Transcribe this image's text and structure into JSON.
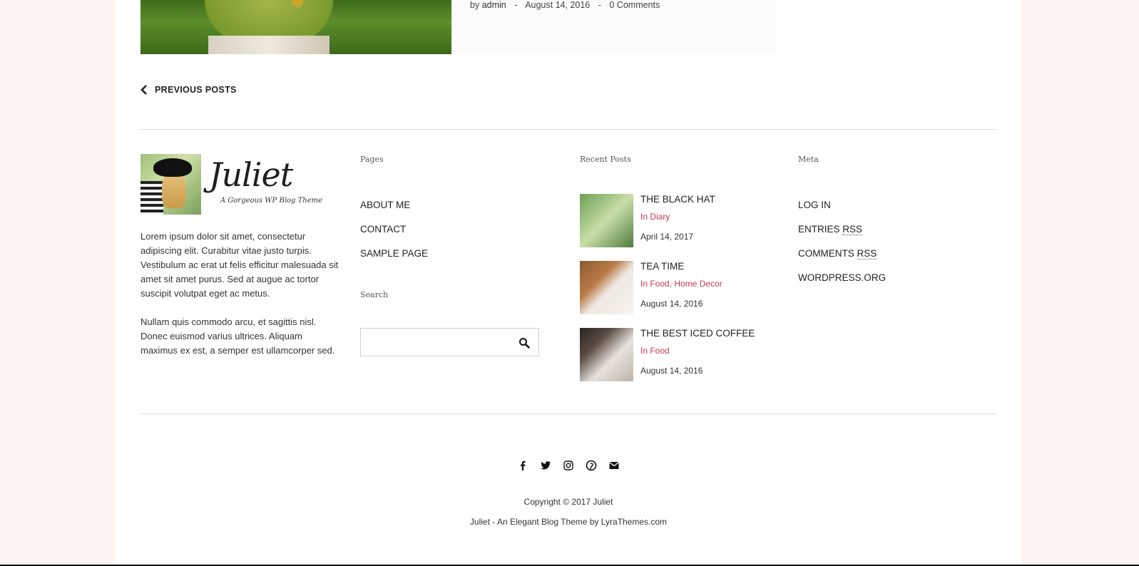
{
  "post": {
    "author_prefix": "by",
    "author": "admin",
    "separator": "-",
    "date": "August 14, 2016",
    "comments": "0 Comments"
  },
  "pagination": {
    "previous_label": "PREVIOUS POSTS"
  },
  "about": {
    "site_title": "Juliet",
    "tagline": "A Gorgeous WP Blog Theme",
    "paragraph_1": "Lorem ipsum dolor sit amet, consectetur adipiscing elit. Curabitur vitae justo turpis. Vestibulum ac erat ut felis efficitur malesuada sit amet sit amet purus. Sed at augue ac tortor suscipit volutpat eget ac metus.",
    "paragraph_2": "Nullam quis commodo arcu, et sagittis nisl. Donec euismod varius ultrices. Aliquam maximus ex est, a semper est ullamcorper sed."
  },
  "pages": {
    "title": "Pages",
    "items": [
      "ABOUT ME",
      "CONTACT",
      "SAMPLE PAGE"
    ]
  },
  "search": {
    "title": "Search",
    "placeholder": "",
    "icon": "search-icon"
  },
  "recent_posts": {
    "title": "Recent Posts",
    "items": [
      {
        "title": "THE BLACK HAT",
        "category": "In Diary",
        "date": "April 14, 2017"
      },
      {
        "title": "TEA TIME",
        "category": "In Food, Home Decor",
        "date": "August 14, 2016"
      },
      {
        "title": "THE BEST ICED COFFEE",
        "category": "In Food",
        "date": "August 14, 2016"
      }
    ]
  },
  "meta": {
    "title": "Meta",
    "login": "LOG IN",
    "entries_prefix": "ENTRIES",
    "comments_prefix": "COMMENTS",
    "rss": "RSS",
    "wordpress": "WORDPRESS.ORG"
  },
  "social": [
    "facebook-icon",
    "twitter-icon",
    "instagram-icon",
    "pinterest-icon",
    "envelope-icon"
  ],
  "footer": {
    "copyright": "Copyright © 2017 Juliet",
    "credit": "Juliet - An Elegant Blog Theme by LyraThemes.com"
  },
  "colors": {
    "accent": "#c8374a",
    "background": "#fdf3f1",
    "text": "#222222"
  }
}
